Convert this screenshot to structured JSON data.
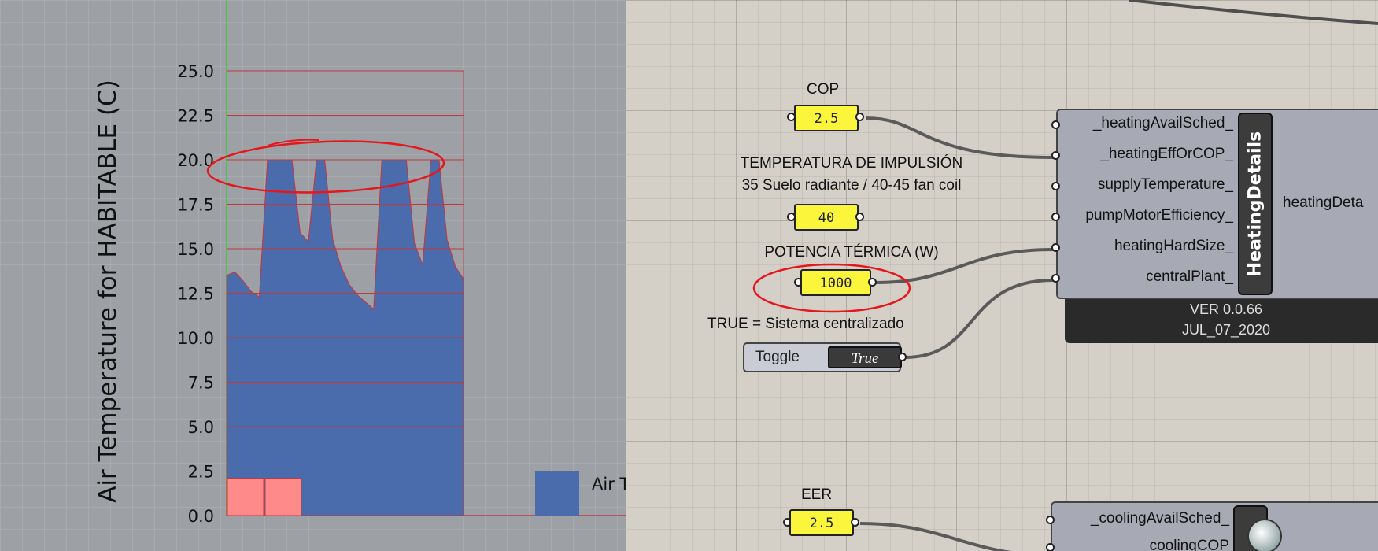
{
  "chart_data": {
    "type": "area",
    "ylabel": "Air Temperature for HABITABLE (C)",
    "ylim": [
      0,
      25
    ],
    "yticks": [
      "25.0",
      "22.5",
      "20.0",
      "17.5",
      "15.0",
      "12.5",
      "10.0",
      "7.5",
      "5.0",
      "2.5",
      "0.0"
    ],
    "ytick_values": [
      25,
      22.5,
      20,
      17.5,
      15,
      12.5,
      10,
      7.5,
      5,
      2.5,
      0
    ],
    "grid": true,
    "series": [
      {
        "values": [
          13.5,
          13.7,
          13.2,
          12.6,
          12.3,
          20,
          20,
          20,
          20,
          15.9,
          15.4,
          20,
          20,
          15.5,
          14,
          13,
          12.4,
          12,
          11.6,
          20,
          20,
          20,
          20,
          15.3,
          14.1,
          20,
          20,
          15.5,
          14,
          13.3
        ],
        "color": "#4a6cad"
      }
    ],
    "highlight_bars": [
      {
        "value": 2.1,
        "color": "#ff8a8a"
      },
      {
        "value": 2.1,
        "color": "#ff8a8a"
      }
    ],
    "legend": {
      "label": "Air T",
      "color": "#4a6cad",
      "placement": "bottom-right"
    }
  },
  "grasshopper": {
    "cop": {
      "label": "COP",
      "value": "2.5"
    },
    "supply_temp": {
      "label_line1": "TEMPERATURA DE IMPULSIÓN",
      "label_line2": "35 Suelo radiante / 40-45 fan coil",
      "value": "40"
    },
    "power": {
      "label": "POTENCIA TÉRMICA (W)",
      "value": "1000"
    },
    "central": {
      "label": "TRUE = Sistema centralizado",
      "toggle_label": "Toggle",
      "toggle_value": "True"
    },
    "heating_component": {
      "inputs": [
        "_heatingAvailSched_",
        "_heatingEffOrCOP_",
        "supplyTemperature_",
        "pumpMotorEfficiency_",
        "heatingHardSize_",
        "centralPlant_"
      ],
      "nickname": "HeatingDetails",
      "output": "heatingDeta",
      "version": "VER 0.0.66",
      "date": "JUL_07_2020"
    },
    "eer": {
      "label": "EER",
      "value": "2.5"
    },
    "cooling_component": {
      "inputs": [
        "_coolingAvailSched_",
        "coolingCOP"
      ]
    }
  }
}
